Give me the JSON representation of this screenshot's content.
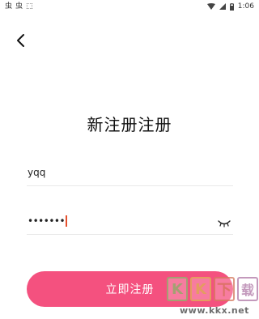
{
  "status_bar": {
    "left_glyphs": [
      "虫",
      "虫",
      "⬚"
    ],
    "time": "1:06"
  },
  "header": {
    "back_icon": "chevron-left-icon"
  },
  "title": "新注册注册",
  "form": {
    "username_value": "yqq",
    "password_value": "•••••••",
    "eye_icon": "eye-closed-icon"
  },
  "submit_label": "立即注册",
  "watermark": {
    "logo_chars": [
      "K",
      "K",
      "下",
      "载"
    ],
    "url": "www.kkx.net"
  },
  "colors": {
    "accent": "#f4517f",
    "caret": "#e5502d"
  }
}
